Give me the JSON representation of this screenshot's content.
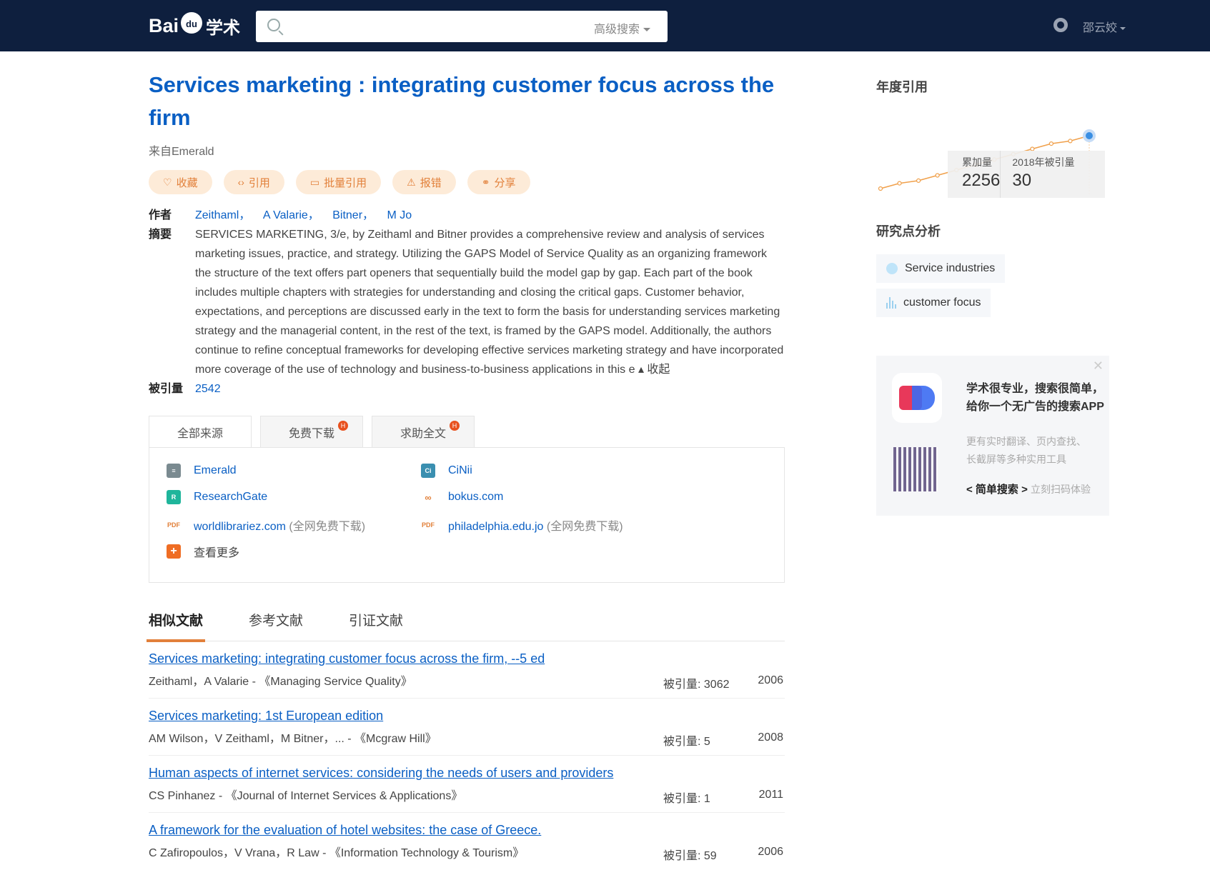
{
  "header": {
    "logo_left": "Bai",
    "logo_paw": "du",
    "logo_right": "学术",
    "search_placeholder": "",
    "advanced_search": "高级搜索",
    "user_name": "邵云姣"
  },
  "paper": {
    "title": "Services marketing : integrating customer focus across the firm",
    "source": "来自Emerald",
    "actions": [
      {
        "icon": "heart-icon",
        "label": "收藏"
      },
      {
        "icon": "code-icon",
        "label": "引用"
      },
      {
        "icon": "folder-icon",
        "label": "批量引用"
      },
      {
        "icon": "warning-icon",
        "label": "报错"
      },
      {
        "icon": "share-icon",
        "label": "分享"
      }
    ],
    "author_label": "作者",
    "authors": [
      "Zeithaml，",
      "A Valarie，",
      "Bitner，",
      "M Jo"
    ],
    "abstract_label": "摘要",
    "abstract": "SERVICES MARKETING, 3/e, by Zeithaml and Bitner provides a comprehensive review and analysis of services marketing issues, practice, and strategy. Utilizing the GAPS Model of Service Quality as an organizing framework the structure of the text offers part openers that sequentially build the model gap by gap. Each part of the book includes multiple chapters with strategies for understanding and closing the critical gaps. Customer behavior, expectations, and perceptions are discussed early in the text to form the basis for understanding services marketing strategy and the managerial content, in the rest of the text, is framed by the GAPS model. Additionally, the authors continue to refine conceptual frameworks for developing effective services marketing strategy and have incorporated more coverage of the use of technology and business-to-business applications in this e",
    "collapse": "收起",
    "cited_label": "被引量",
    "cited_value": "2542"
  },
  "source_tabs": [
    {
      "label": "全部来源",
      "badge": ""
    },
    {
      "label": "免费下载",
      "badge": "H"
    },
    {
      "label": "求助全文",
      "badge": "H"
    }
  ],
  "sources": [
    {
      "icon": "emerald-icon",
      "name": "Emerald",
      "extra": ""
    },
    {
      "icon": "cinii-icon",
      "name": "CiNii",
      "extra": ""
    },
    {
      "icon": "researchgate-icon",
      "name": "ResearchGate",
      "extra": ""
    },
    {
      "icon": "link-icon",
      "name": "bokus.com",
      "extra": ""
    },
    {
      "icon": "pdf-icon",
      "name": "worldlibrariez.com",
      "extra": "(全网免费下载)"
    },
    {
      "icon": "pdf-icon",
      "name": "philadelphia.edu.jo",
      "extra": "(全网免费下载)"
    },
    {
      "icon": "plus-icon",
      "name": "查看更多",
      "extra": ""
    }
  ],
  "pdf_text": "PDF",
  "lit_tabs": [
    "相似文献",
    "参考文献",
    "引证文献"
  ],
  "literature": [
    {
      "title": "Services marketing: integrating customer focus across the firm, --5 ed",
      "authors": "Zeithaml，A Valarie - 《Managing Service Quality》",
      "cited": "被引量: 3062",
      "year": "2006"
    },
    {
      "title": "Services marketing: 1st European edition",
      "authors": "AM Wilson，V Zeithaml，M Bitner，... - 《Mcgraw Hill》",
      "cited": "被引量: 5",
      "year": "2008"
    },
    {
      "title": "Human aspects of internet services: considering the needs of users and providers",
      "authors": "CS Pinhanez - 《Journal of Internet Services & Applications》",
      "cited": "被引量: 1",
      "year": "2011"
    },
    {
      "title": "A framework for the evaluation of hotel websites: the case of Greece.",
      "authors": "C Zafiropoulos，V Vrana，R Law - 《Information Technology & Tourism》",
      "cited": "被引量: 59",
      "year": "2006"
    }
  ],
  "sidebar": {
    "annual_title": "年度引用",
    "tip_cumulative_label": "累加量",
    "tip_cumulative_value": "2256",
    "tip_year_label": "2018年被引量",
    "tip_year_value": "30",
    "research_title": "研究点分析",
    "topics": [
      "Service industries",
      "customer focus"
    ],
    "app_line1": "学术很专业，搜索很简单，",
    "app_line2": "给你一个无广告的搜索APP",
    "app_line3": "更有实时翻译、页内查找、",
    "app_line4": "长截屏等多种实用工具",
    "app_link": "< 简单搜索 >",
    "app_scan": "立刻扫码体验",
    "close": "✕"
  },
  "chart_data": {
    "type": "line",
    "values": [
      0,
      1,
      1.5,
      2.5,
      3.5,
      4.5,
      5.5,
      6.5,
      7.5,
      8.5,
      9,
      10
    ],
    "highlight_index": 11,
    "accent": "#f0a04b",
    "highlight_color": "#3b8fe3"
  }
}
